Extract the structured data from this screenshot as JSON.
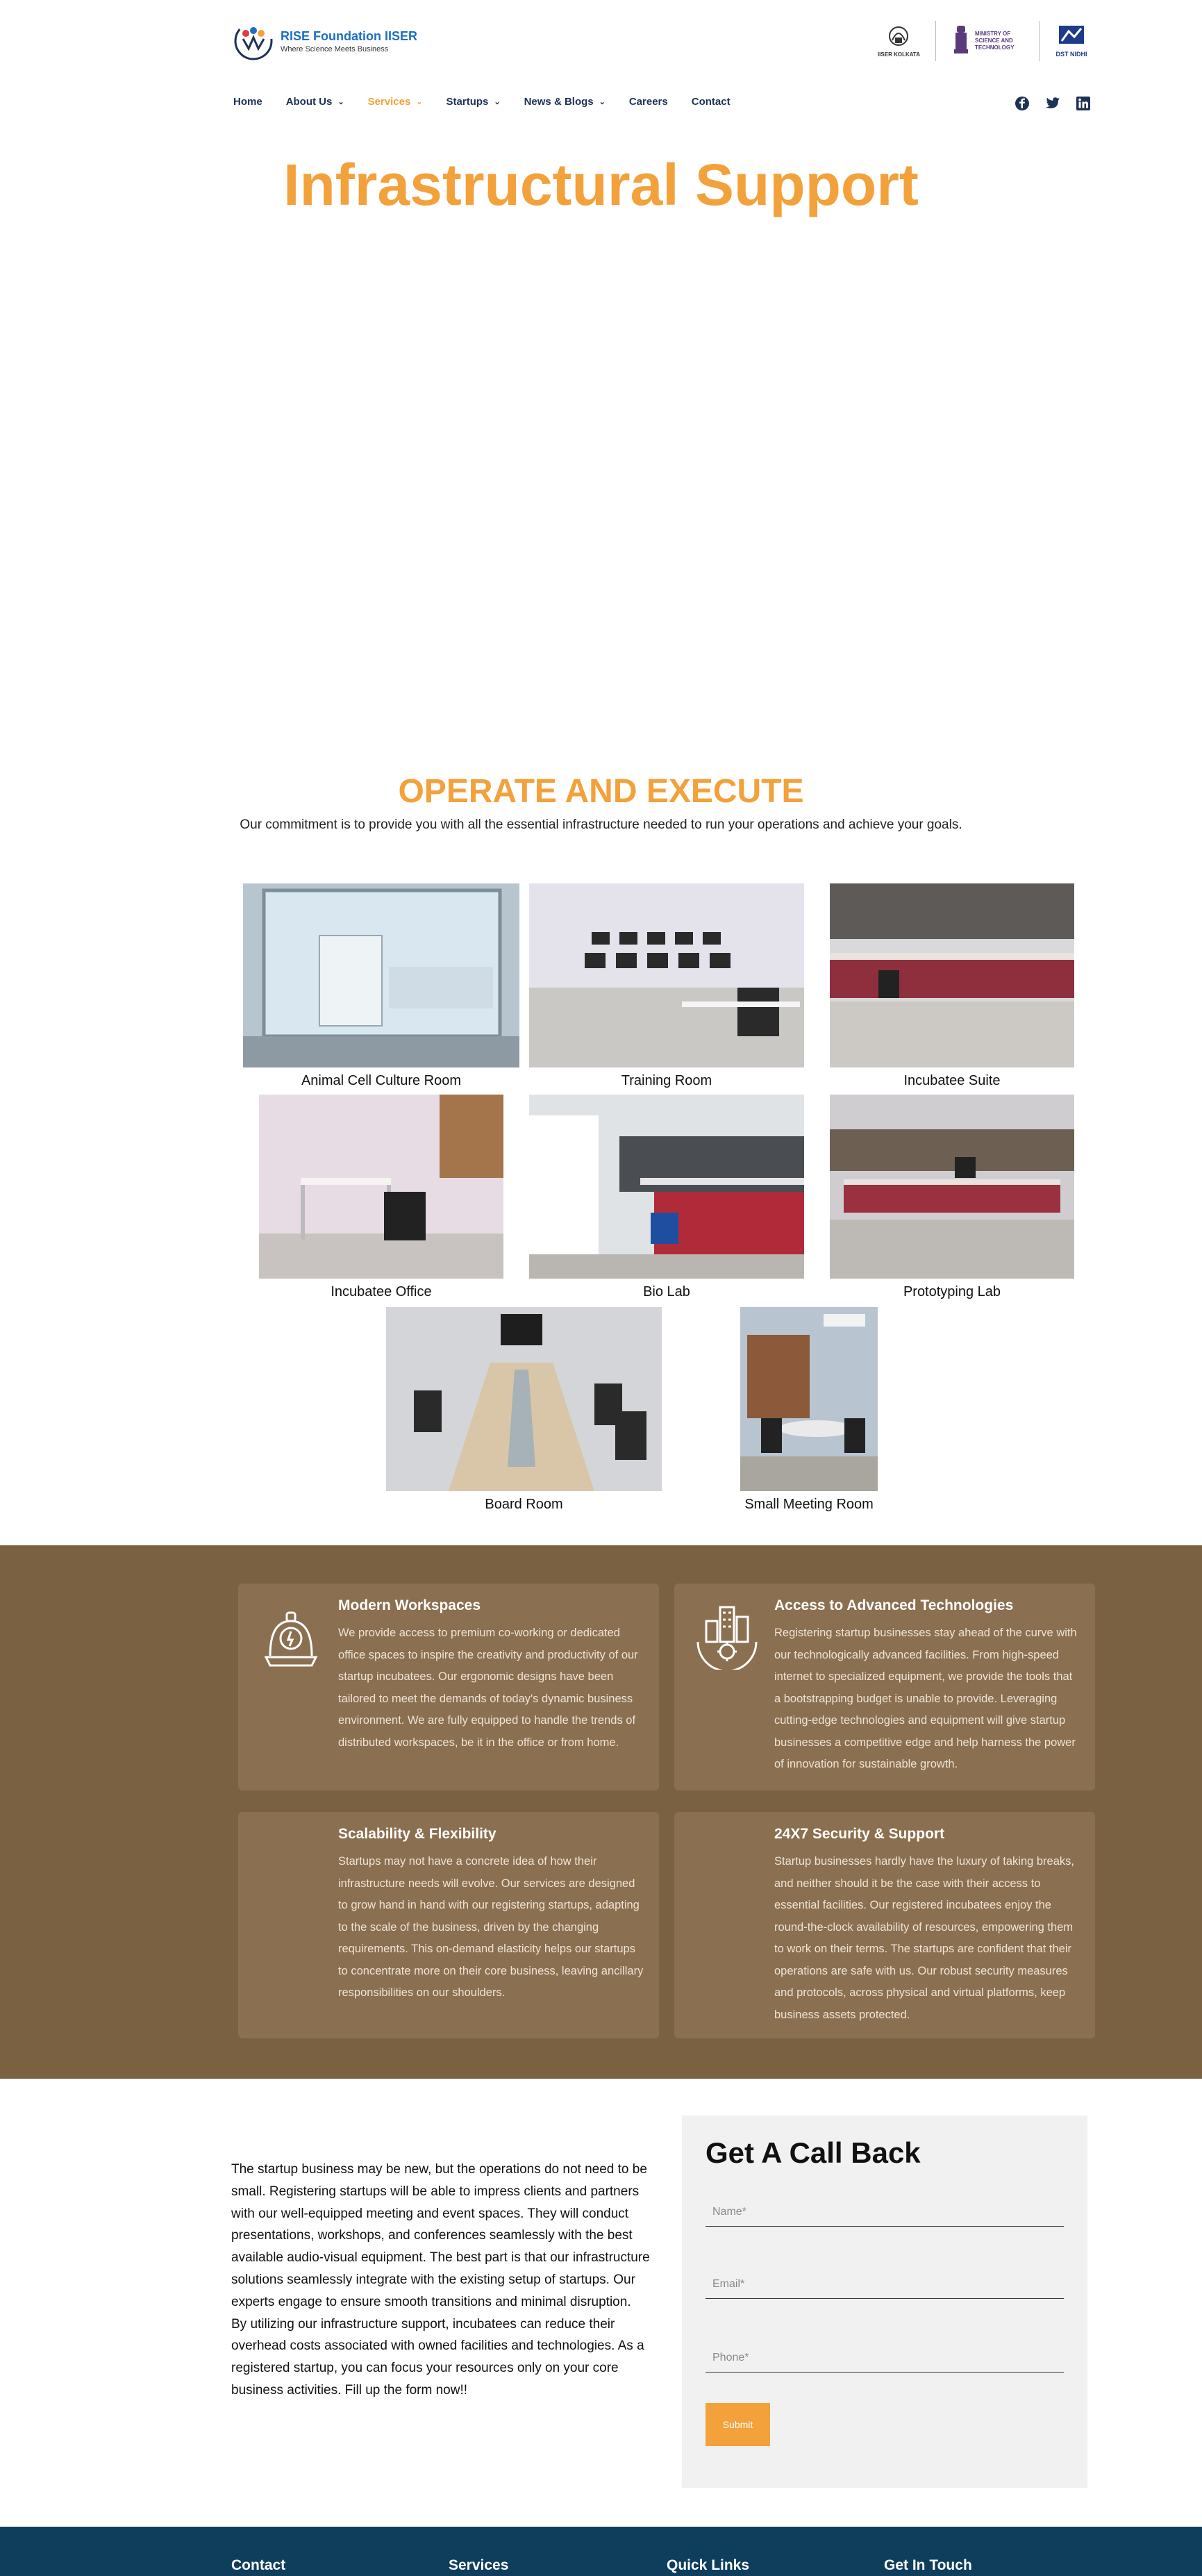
{
  "header": {
    "logo_title": "RISE Foundation IISER",
    "logo_tagline": "Where Science Meets Business",
    "partners": [
      {
        "name": "iiser-kolkata-logo",
        "text": "IISER KOLKATA"
      },
      {
        "name": "ministry-logo",
        "text": "MINISTRY OF SCIENCE AND TECHNOLOGY"
      },
      {
        "name": "dst-nidhi-logo",
        "text": "DST NIDHI"
      }
    ]
  },
  "nav": {
    "items": [
      {
        "label": "Home",
        "dropdown": false
      },
      {
        "label": "About Us",
        "dropdown": true
      },
      {
        "label": "Services",
        "dropdown": true,
        "active": true
      },
      {
        "label": "Startups",
        "dropdown": true
      },
      {
        "label": "News & Blogs",
        "dropdown": true
      },
      {
        "label": "Careers",
        "dropdown": false
      },
      {
        "label": "Contact",
        "dropdown": false
      }
    ],
    "social": [
      "facebook-icon",
      "twitter-icon",
      "linkedin-icon"
    ]
  },
  "hero": {
    "title": "Infrastructural Support"
  },
  "operate": {
    "heading": "OPERATE AND EXECUTE",
    "subtitle": "Our commitment is to provide you with all the essential infrastructure needed to run your operations and achieve your goals."
  },
  "gallery": [
    {
      "caption": "Animal Cell Culture Room"
    },
    {
      "caption": "Training Room"
    },
    {
      "caption": "Incubatee Suite"
    },
    {
      "caption": "Incubatee Office"
    },
    {
      "caption": "Bio Lab"
    },
    {
      "caption": "Prototyping Lab"
    },
    {
      "caption": "Board Room"
    },
    {
      "caption": "Small Meeting Room"
    }
  ],
  "features": [
    {
      "title": "Modern Workspaces",
      "icon": "bell-desk-icon",
      "text": "We provide access to premium co-working or dedicated office spaces to inspire the creativity and productivity of our startup incubatees. Our ergonomic designs have been tailored to meet the demands of today's dynamic business environment. We are fully equipped to handle the trends of distributed workspaces, be it in the office or from home."
    },
    {
      "title": "Access to Advanced Technologies",
      "icon": "city-gear-icon",
      "text": "Registering startup businesses stay ahead of the curve with our technologically advanced facilities. From high-speed internet to specialized equipment, we provide the tools that a bootstrapping budget is unable to provide. Leveraging cutting-edge technologies and equipment will give startup businesses a competitive edge and help harness the power of innovation for sustainable growth."
    },
    {
      "title": "Scalability & Flexibility",
      "icon": "",
      "text": "Startups may not have a concrete idea of how their infrastructure needs will evolve. Our services are designed to grow hand in hand with our registering startups, adapting to the scale of the business, driven by the changing requirements. This on-demand elasticity helps our startups to concentrate more on their core business, leaving ancillary responsibilities on our shoulders."
    },
    {
      "title": "24X7 Security & Support",
      "icon": "",
      "text": "Startup businesses hardly have the luxury of taking breaks, and neither should it be the case with their access to essential facilities. Our registered incubatees enjoy the round-the-clock availability of resources, empowering them to work on their terms. The startups are confident that their operations are safe with us. Our robust security measures and protocols, across physical and virtual platforms, keep business assets protected."
    }
  ],
  "callback": {
    "paragraph1": "The startup business may be new, but the operations do not need to be small. Registering startups will be able to impress clients and partners with our well-equipped meeting and event spaces. They will conduct presentations, workshops, and conferences seamlessly with the best available audio-visual equipment. The best part is that our infrastructure solutions seamlessly integrate with the existing setup of startups. Our experts engage to ensure smooth transitions and minimal disruption.",
    "paragraph2": "By utilizing our infrastructure support, incubatees can reduce their overhead costs associated with owned facilities and technologies. As a registered startup, you can focus your resources only on your core business activities. Fill up the form now!!",
    "form_title": "Get A Call Back",
    "name_placeholder": "Name*",
    "email_placeholder": "Email*",
    "phone_placeholder": "Phone*",
    "submit_label": "Submit"
  },
  "footer": {
    "columns": [
      "Contact",
      "Services",
      "Quick Links",
      "Get In Touch"
    ]
  },
  "colors": {
    "accent": "#f2a13b",
    "nav_text": "#1e3255",
    "features_bg": "#7a6142",
    "card_bg": "#8a6f50",
    "footer_bg": "#0f3d5c"
  }
}
